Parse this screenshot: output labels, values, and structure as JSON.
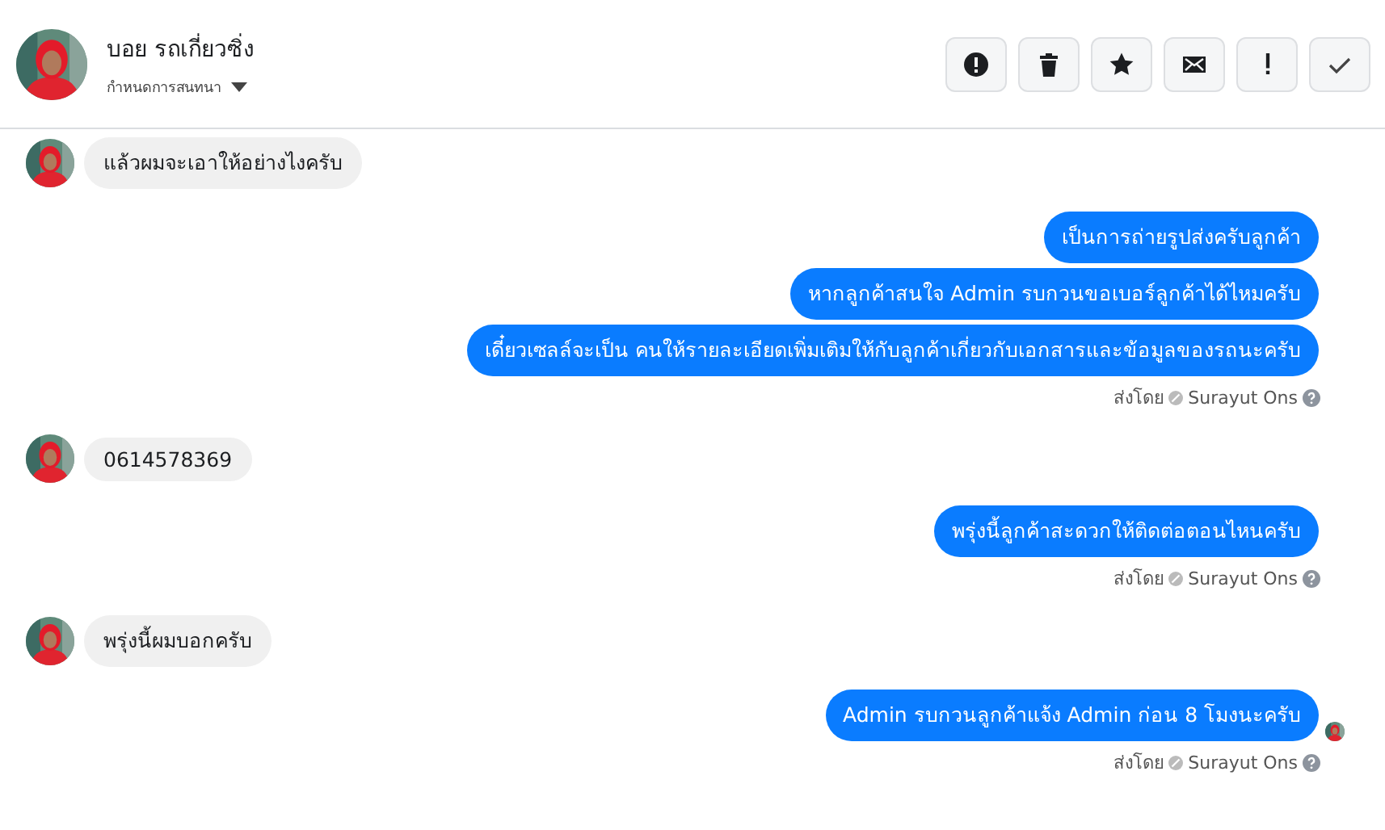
{
  "header": {
    "name": "บอย รถเกี่ยวซิ่ง",
    "subtitle": "กำหนดการสนทนา",
    "actions": [
      {
        "kind": "alert"
      },
      {
        "kind": "trash"
      },
      {
        "kind": "star"
      },
      {
        "kind": "mail"
      },
      {
        "kind": "exclaim"
      },
      {
        "kind": "check"
      }
    ]
  },
  "messages": [
    {
      "kind": "incoming",
      "text": "แล้วผมจะเอาให้อย่างไงครับ"
    },
    {
      "kind": "outgoing",
      "bubbles": [
        "เป็นการถ่ายรูปส่งครับลูกค้า",
        "หากลูกค้าสนใจ Admin รบกวนขอเบอร์ลูกค้าได้ไหมครับ",
        "เดี๋ยวเซลล์จะเป็น คนให้รายละเอียดเพิ่มเติมให้กับลูกค้าเกี่ยวกับเอกสารและข้อมูลของรถนะครับ"
      ],
      "sent_label": "ส่งโดย",
      "sender": "Surayut Ons",
      "seen": false
    },
    {
      "kind": "incoming",
      "text": "0614578369"
    },
    {
      "kind": "outgoing",
      "bubbles": [
        "พรุ่งนี้ลูกค้าสะดวกให้ติดต่อตอนไหนครับ"
      ],
      "sent_label": "ส่งโดย",
      "sender": "Surayut Ons",
      "seen": false
    },
    {
      "kind": "incoming",
      "text": "พรุ่งนี้ผมบอกครับ"
    },
    {
      "kind": "outgoing",
      "bubbles": [
        "Admin รบกวนลูกค้าแจ้ง Admin ก่อน 8 โมงนะครับ"
      ],
      "sent_label": "ส่งโดย",
      "sender": "Surayut Ons",
      "seen": true
    }
  ]
}
